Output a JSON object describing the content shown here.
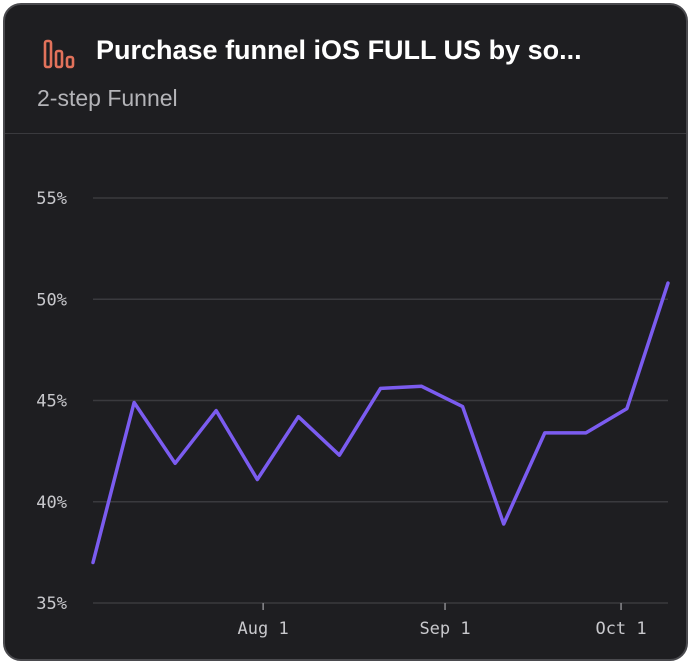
{
  "card": {
    "title": "Purchase funnel iOS FULL US by so...",
    "subtitle": "2-step Funnel",
    "icon": "funnel-bars-icon"
  },
  "colors": {
    "background": "#1e1e21",
    "line": "#7b5cf0",
    "icon": "#e2725b",
    "grid": "#3a3a3e"
  },
  "chart_data": {
    "type": "line",
    "title": "",
    "xlabel": "",
    "ylabel": "",
    "x_ticks": [
      "Aug 1",
      "Sep 1",
      "Oct 1"
    ],
    "y_ticks": [
      "35%",
      "40%",
      "45%",
      "50%",
      "55%"
    ],
    "ylim": [
      35,
      55
    ],
    "grid": true,
    "series": [
      {
        "x": [
          "2023-07-03",
          "2023-07-10",
          "2023-07-17",
          "2023-07-24",
          "2023-07-31",
          "2023-08-07",
          "2023-08-14",
          "2023-08-21",
          "2023-08-28",
          "2023-09-04",
          "2023-09-11",
          "2023-09-18",
          "2023-09-25",
          "2023-10-02",
          "2023-10-09"
        ],
        "values": [
          37.0,
          44.9,
          41.9,
          44.5,
          41.1,
          44.2,
          42.3,
          45.6,
          45.7,
          44.7,
          38.9,
          43.4,
          43.4,
          44.6,
          50.8
        ]
      }
    ]
  }
}
